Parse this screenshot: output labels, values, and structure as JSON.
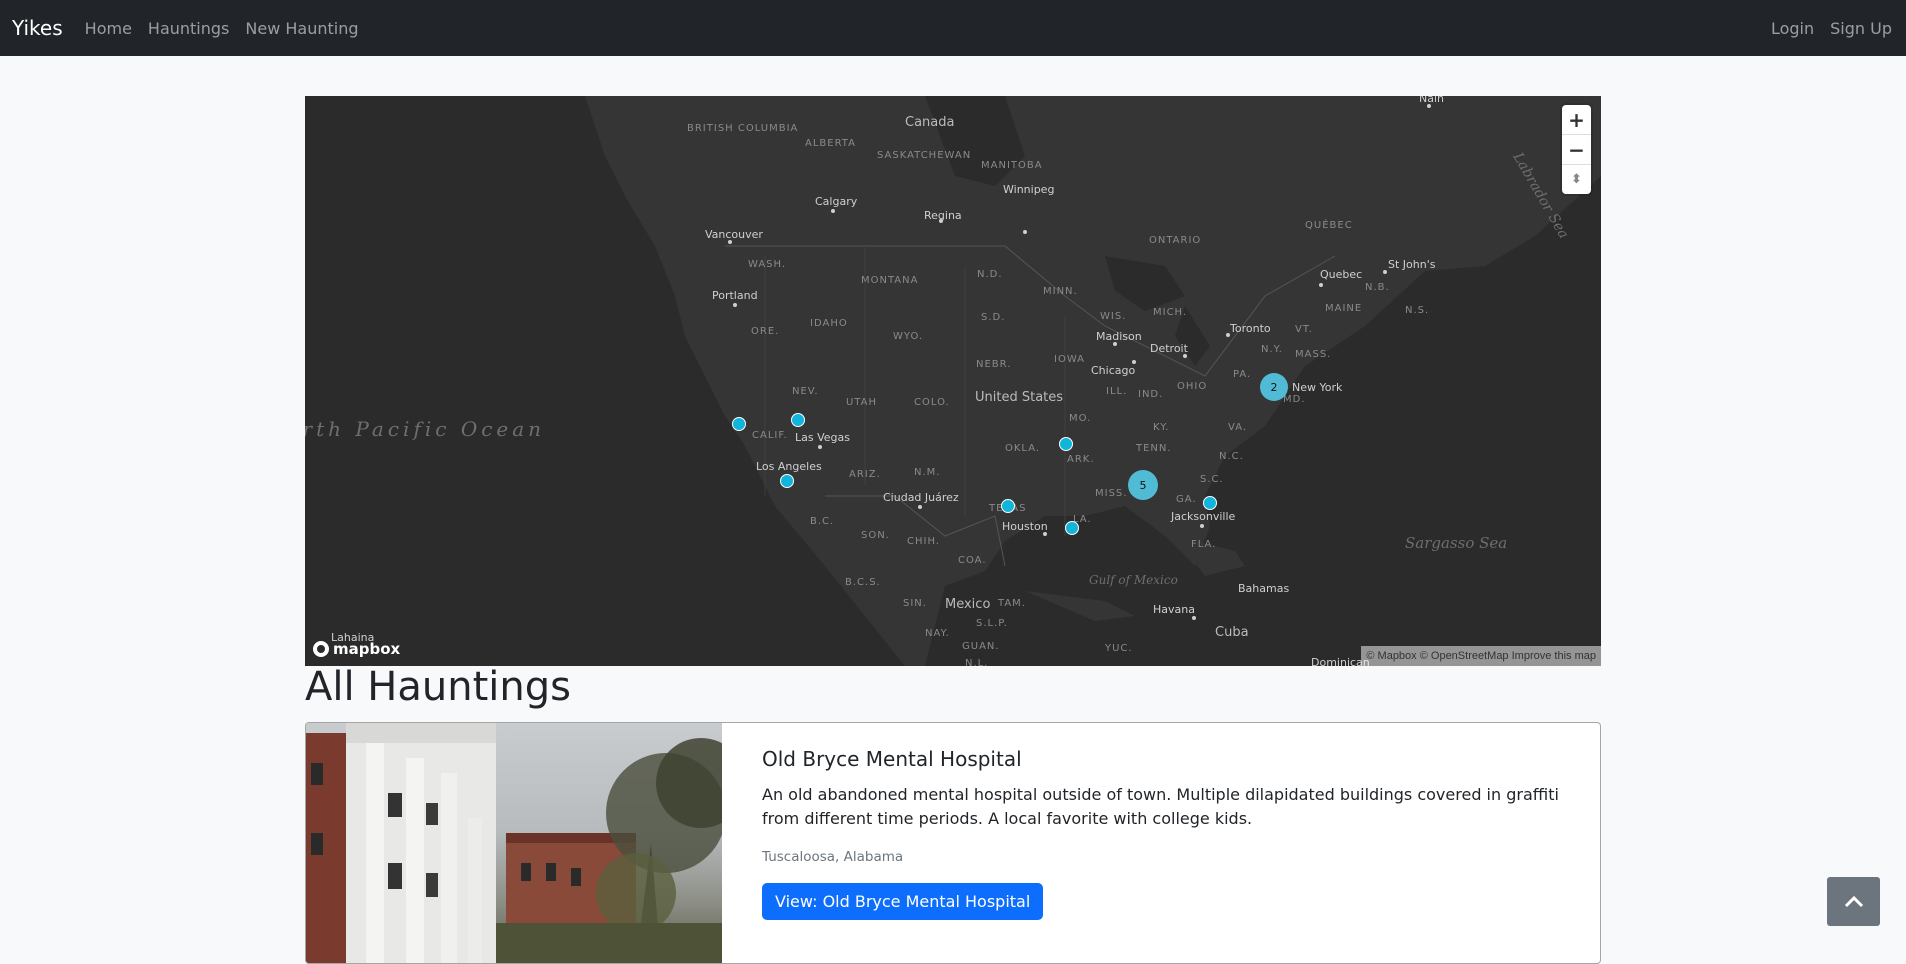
{
  "navbar": {
    "brand": "Yikes",
    "links": [
      "Home",
      "Hauntings",
      "New Haunting"
    ],
    "right_links": [
      "Login",
      "Sign Up"
    ]
  },
  "map": {
    "country_labels": [
      "Canada",
      "United States",
      "Mexico",
      "Cuba"
    ],
    "region_labels": [
      "BRITISH COLUMBIA",
      "ALBERTA",
      "SASKATCHEWAN",
      "MANITOBA",
      "ONTARIO",
      "QUÉBEC",
      "WASH.",
      "MONTANA",
      "N.D.",
      "MINN.",
      "ORE.",
      "IDAHO",
      "WYO.",
      "S.D.",
      "WIS.",
      "MICH.",
      "NEV.",
      "UTAH",
      "COLO.",
      "NEBR.",
      "IOWA",
      "ILL.",
      "IND.",
      "OHIO",
      "PA.",
      "N.Y.",
      "VT.",
      "MAINE",
      "N.B.",
      "N.S.",
      "MASS.",
      "CALIF.",
      "ARIZ.",
      "N.M.",
      "OKLA.",
      "MO.",
      "KY.",
      "VA.",
      "ARK.",
      "TENN.",
      "N.C.",
      "S.C.",
      "MISS.",
      "GA.",
      "TEXAS",
      "LA.",
      "FLA.",
      "B.C.",
      "SON.",
      "CHIH.",
      "COA.",
      "B.C.S.",
      "SIN.",
      "TAM.",
      "S.L.P.",
      "NAY.",
      "GUAN.",
      "YUC.",
      "N.L.",
      "MD."
    ],
    "city_labels": [
      "Calgary",
      "Regina",
      "Winnipeg",
      "Vancouver",
      "Portland",
      "Madison",
      "Detroit",
      "Toronto",
      "Quebec",
      "St John's",
      "Chicago",
      "New York",
      "Las Vegas",
      "Los Angeles",
      "Ciudad Juárez",
      "Houston",
      "Jacksonville",
      "Havana",
      "Bahamas",
      "Nain",
      "Lahaina",
      "Dominican"
    ],
    "water_labels": [
      "Sargasso Sea",
      "Gulf of Mexico",
      "Labrador Sea",
      "North Pacific Ocean"
    ],
    "clusters": [
      {
        "count": "2",
        "color": "#51bbd6"
      },
      {
        "count": "5",
        "color": "#51bbd6"
      }
    ],
    "marker_color": "#11b4da",
    "controls": {
      "zoom_in": "+",
      "zoom_out": "−",
      "compass": "⬍"
    },
    "logo_text": "mapbox",
    "attribution": [
      "© Mapbox",
      "© OpenStreetMap",
      "Improve this map"
    ]
  },
  "page": {
    "heading": "All Hauntings"
  },
  "hauntings": [
    {
      "title": "Old Bryce Mental Hospital",
      "description": "An old abandoned mental hospital outside of town. Multiple dilapidated buildings covered in graffiti from different time periods. A local favorite with college kids.",
      "location": "Tuscaloosa, Alabama",
      "button_label": "View: Old Bryce Mental Hospital"
    }
  ],
  "colors": {
    "navbar_bg": "#212529",
    "primary": "#0d6efd",
    "map_bg": "#2b2b2b",
    "scroll_top_bg": "#6c757d"
  },
  "scroll_top_icon": "chevron-up-icon"
}
